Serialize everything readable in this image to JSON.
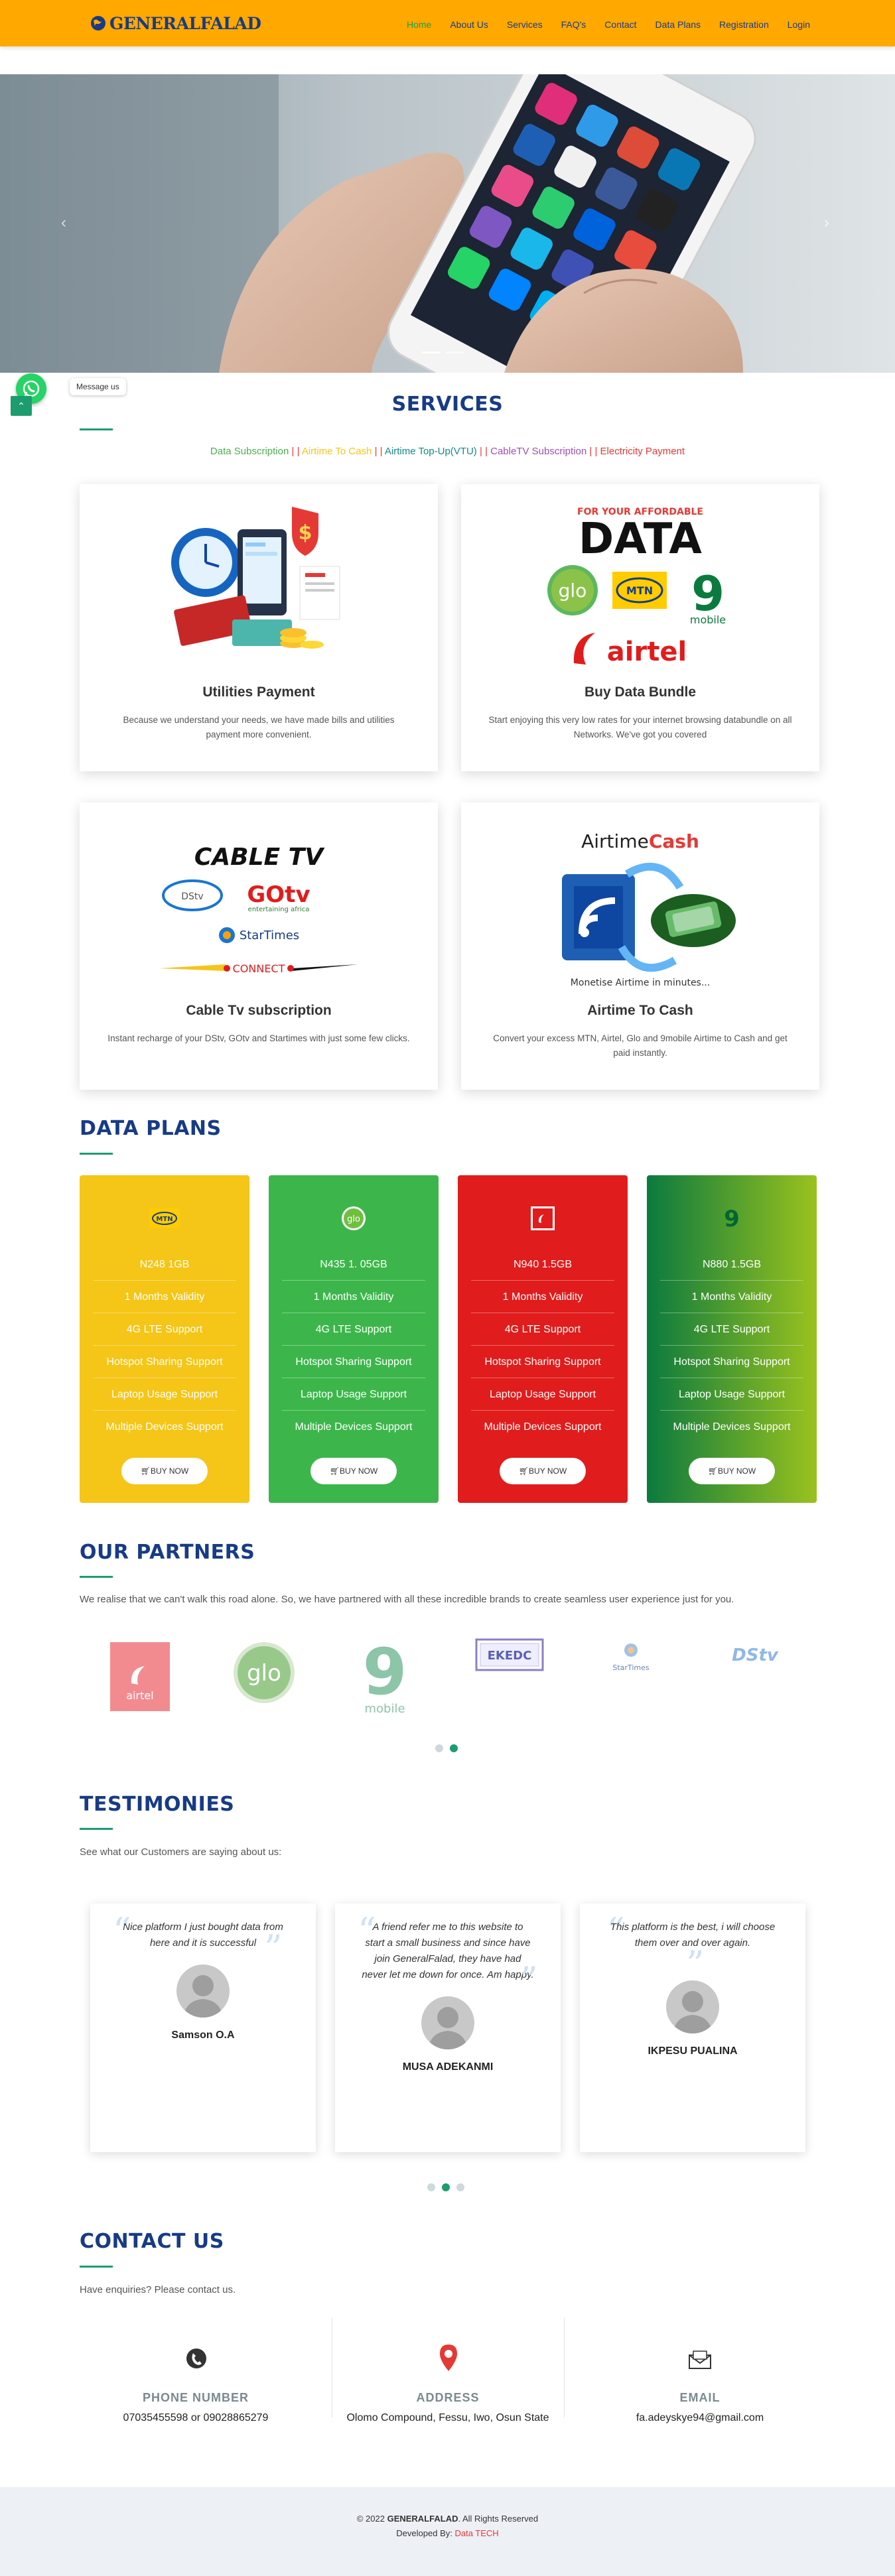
{
  "brand": {
    "name": "GENERALFALAD"
  },
  "nav": {
    "items": [
      {
        "label": "Home",
        "active": true
      },
      {
        "label": "About Us"
      },
      {
        "label": "Services"
      },
      {
        "label": "FAQ's"
      },
      {
        "label": "Contact"
      },
      {
        "label": "Data Plans"
      },
      {
        "label": "Registration"
      },
      {
        "label": "Login"
      }
    ]
  },
  "whatsapp": {
    "message": "Message us"
  },
  "services": {
    "title": "SERVICES",
    "links": [
      {
        "label": "Data Subscription",
        "color": "#4caf50"
      },
      {
        "label": "Airtime To Cash",
        "color": "#f5c518"
      },
      {
        "label": "Airtime Top-Up(VTU)",
        "color": "#138a8a"
      },
      {
        "label": "CableTV Subscription",
        "color": "#9c4fb5"
      },
      {
        "label": "Electricity Payment",
        "color": "#e53935"
      }
    ],
    "separator": "| |",
    "cards": [
      {
        "title": "Utilities Payment",
        "desc": "Because we understand your needs, we have made bills and utilities payment more convenient."
      },
      {
        "title": "Buy Data Bundle",
        "desc": "Start enjoying this very low rates for your internet browsing databundle on all Networks. We've got you covered",
        "art_top": "FOR YOUR AFFORDABLE",
        "art_main": "DATA",
        "art_glo": "glo",
        "art_mtn": "MTN",
        "art_9": "9",
        "art_mobile": "mobile",
        "art_airtel": "airtel"
      },
      {
        "title": "Cable Tv subscription",
        "desc": "Instant recharge of your DStv, GOtv and Startimes with just some few clicks.",
        "art_main": "CABLE TV",
        "art_dstv": "DStv",
        "art_gotv": "GOtv",
        "art_gotv_sub": "entertaining africa",
        "art_startimes": "StarTimes",
        "art_connect": "CONNECT"
      },
      {
        "title": "Airtime To Cash",
        "desc": "Convert your excess MTN, Airtel, Glo and 9mobile Airtime to Cash and get paid instantly.",
        "art_a": "Airtime",
        "art_b": "Cash",
        "art_caption": "Monetise Airtime in minutes..."
      }
    ]
  },
  "plans": {
    "title": "DATA PLANS",
    "features": [
      "1 Months Validity",
      "4G LTE Support",
      "Hotspot Sharing Support",
      "Laptop Usage Support",
      "Multiple Devices Support"
    ],
    "buy_label": "BUY NOW",
    "items": [
      {
        "price": "N248 1GB",
        "network": "mtn",
        "color": "#f5c518"
      },
      {
        "price": "N435 1. 05GB",
        "network": "glo",
        "color": "#3cb64a"
      },
      {
        "price": "N940 1.5GB",
        "network": "airtel",
        "color": "#e01c1c"
      },
      {
        "price": "N880 1.5GB",
        "network": "9mobile",
        "color": "#0b7a3e"
      }
    ]
  },
  "partners": {
    "title": "OUR PARTNERS",
    "intro": "We realise that we can't walk this road alone. So, we have partnered with all these incredible brands to create seamless user experience just for you.",
    "logos": [
      {
        "name": "airtel",
        "label": "airtel"
      },
      {
        "name": "glo",
        "label": "glo"
      },
      {
        "name": "9mobile",
        "label": "9",
        "sub": "mobile"
      },
      {
        "name": "ekedc",
        "label": "EKEDC"
      },
      {
        "name": "startimes",
        "label": "StarTimes"
      },
      {
        "name": "dstv",
        "label": "DStv"
      }
    ]
  },
  "testimonies": {
    "title": "TESTIMONIES",
    "intro": "See what our Customers are saying about us:",
    "items": [
      {
        "quote": "Nice platform I just bought data from here and it is successful",
        "name": "Samson O.A"
      },
      {
        "quote": "A friend refer me to this website to start a small business and since have join GeneralFalad, they have had never let me down for once. Am happy.",
        "name": "MUSA ADEKANMI"
      },
      {
        "quote": "This platform is the best, i will choose them over and over again.",
        "name": "IKPESU PUALINA"
      }
    ]
  },
  "contact": {
    "title": "CONTACT US",
    "intro": "Have enquiries? Please contact us.",
    "phone": {
      "label": "PHONE NUMBER",
      "value": "07035455598 or 09028865279"
    },
    "address": {
      "label": "ADDRESS",
      "value": "Olomo Compound, Fessu, Iwo, Osun State"
    },
    "email": {
      "label": "EMAIL",
      "value": "fa.adeyskye94@gmail.com"
    }
  },
  "footer": {
    "copy_prefix": "© 2022 ",
    "copy_brand": "GENERALFALAD",
    "copy_suffix": ". All Rights Reserved",
    "dev_prefix": "Developed By: ",
    "dev_name": "Data TECH"
  }
}
